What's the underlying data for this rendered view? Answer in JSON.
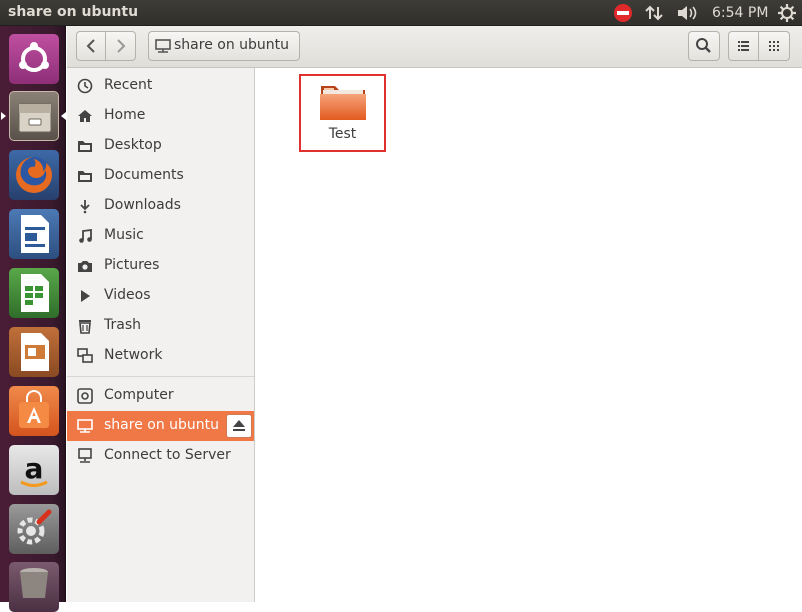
{
  "topbar": {
    "title": "share on ubuntu",
    "clock": "6:54 PM",
    "indicators": [
      "stop-icon",
      "network-updown-icon",
      "volume-icon",
      "settings-gear-icon"
    ]
  },
  "launcher": {
    "items": [
      "ubuntu-dash-icon",
      "files-icon",
      "firefox-icon",
      "libreoffice-writer-icon",
      "libreoffice-calc-icon",
      "libreoffice-impress-icon",
      "software-center-icon",
      "amazon-icon",
      "system-settings-icon",
      "trash-icon"
    ]
  },
  "headerbar": {
    "path_label": "share on ubuntu"
  },
  "sidebar": {
    "places": [
      {
        "label": "Recent",
        "icon": "clock-icon"
      },
      {
        "label": "Home",
        "icon": "home-icon"
      },
      {
        "label": "Desktop",
        "icon": "folder-icon"
      },
      {
        "label": "Documents",
        "icon": "folder-icon"
      },
      {
        "label": "Downloads",
        "icon": "download-icon"
      },
      {
        "label": "Music",
        "icon": "music-note-icon"
      },
      {
        "label": "Pictures",
        "icon": "camera-icon"
      },
      {
        "label": "Videos",
        "icon": "film-icon"
      },
      {
        "label": "Trash",
        "icon": "trash-icon"
      },
      {
        "label": "Network",
        "icon": "network-icon"
      }
    ],
    "devices": [
      {
        "label": "Computer",
        "icon": "computer-icon"
      },
      {
        "label": "share on ubuntu",
        "icon": "network-share-icon",
        "active": true
      },
      {
        "label": "Connect to Server",
        "icon": "server-icon"
      }
    ]
  },
  "content": {
    "items": [
      {
        "label": "Test",
        "icon": "folder-icon"
      }
    ]
  },
  "colors": {
    "accent": "#f07746",
    "highlight_box": "#e03030",
    "launcher_bg": "#3a1a2e",
    "topbar_bg": "#3c3b37"
  }
}
